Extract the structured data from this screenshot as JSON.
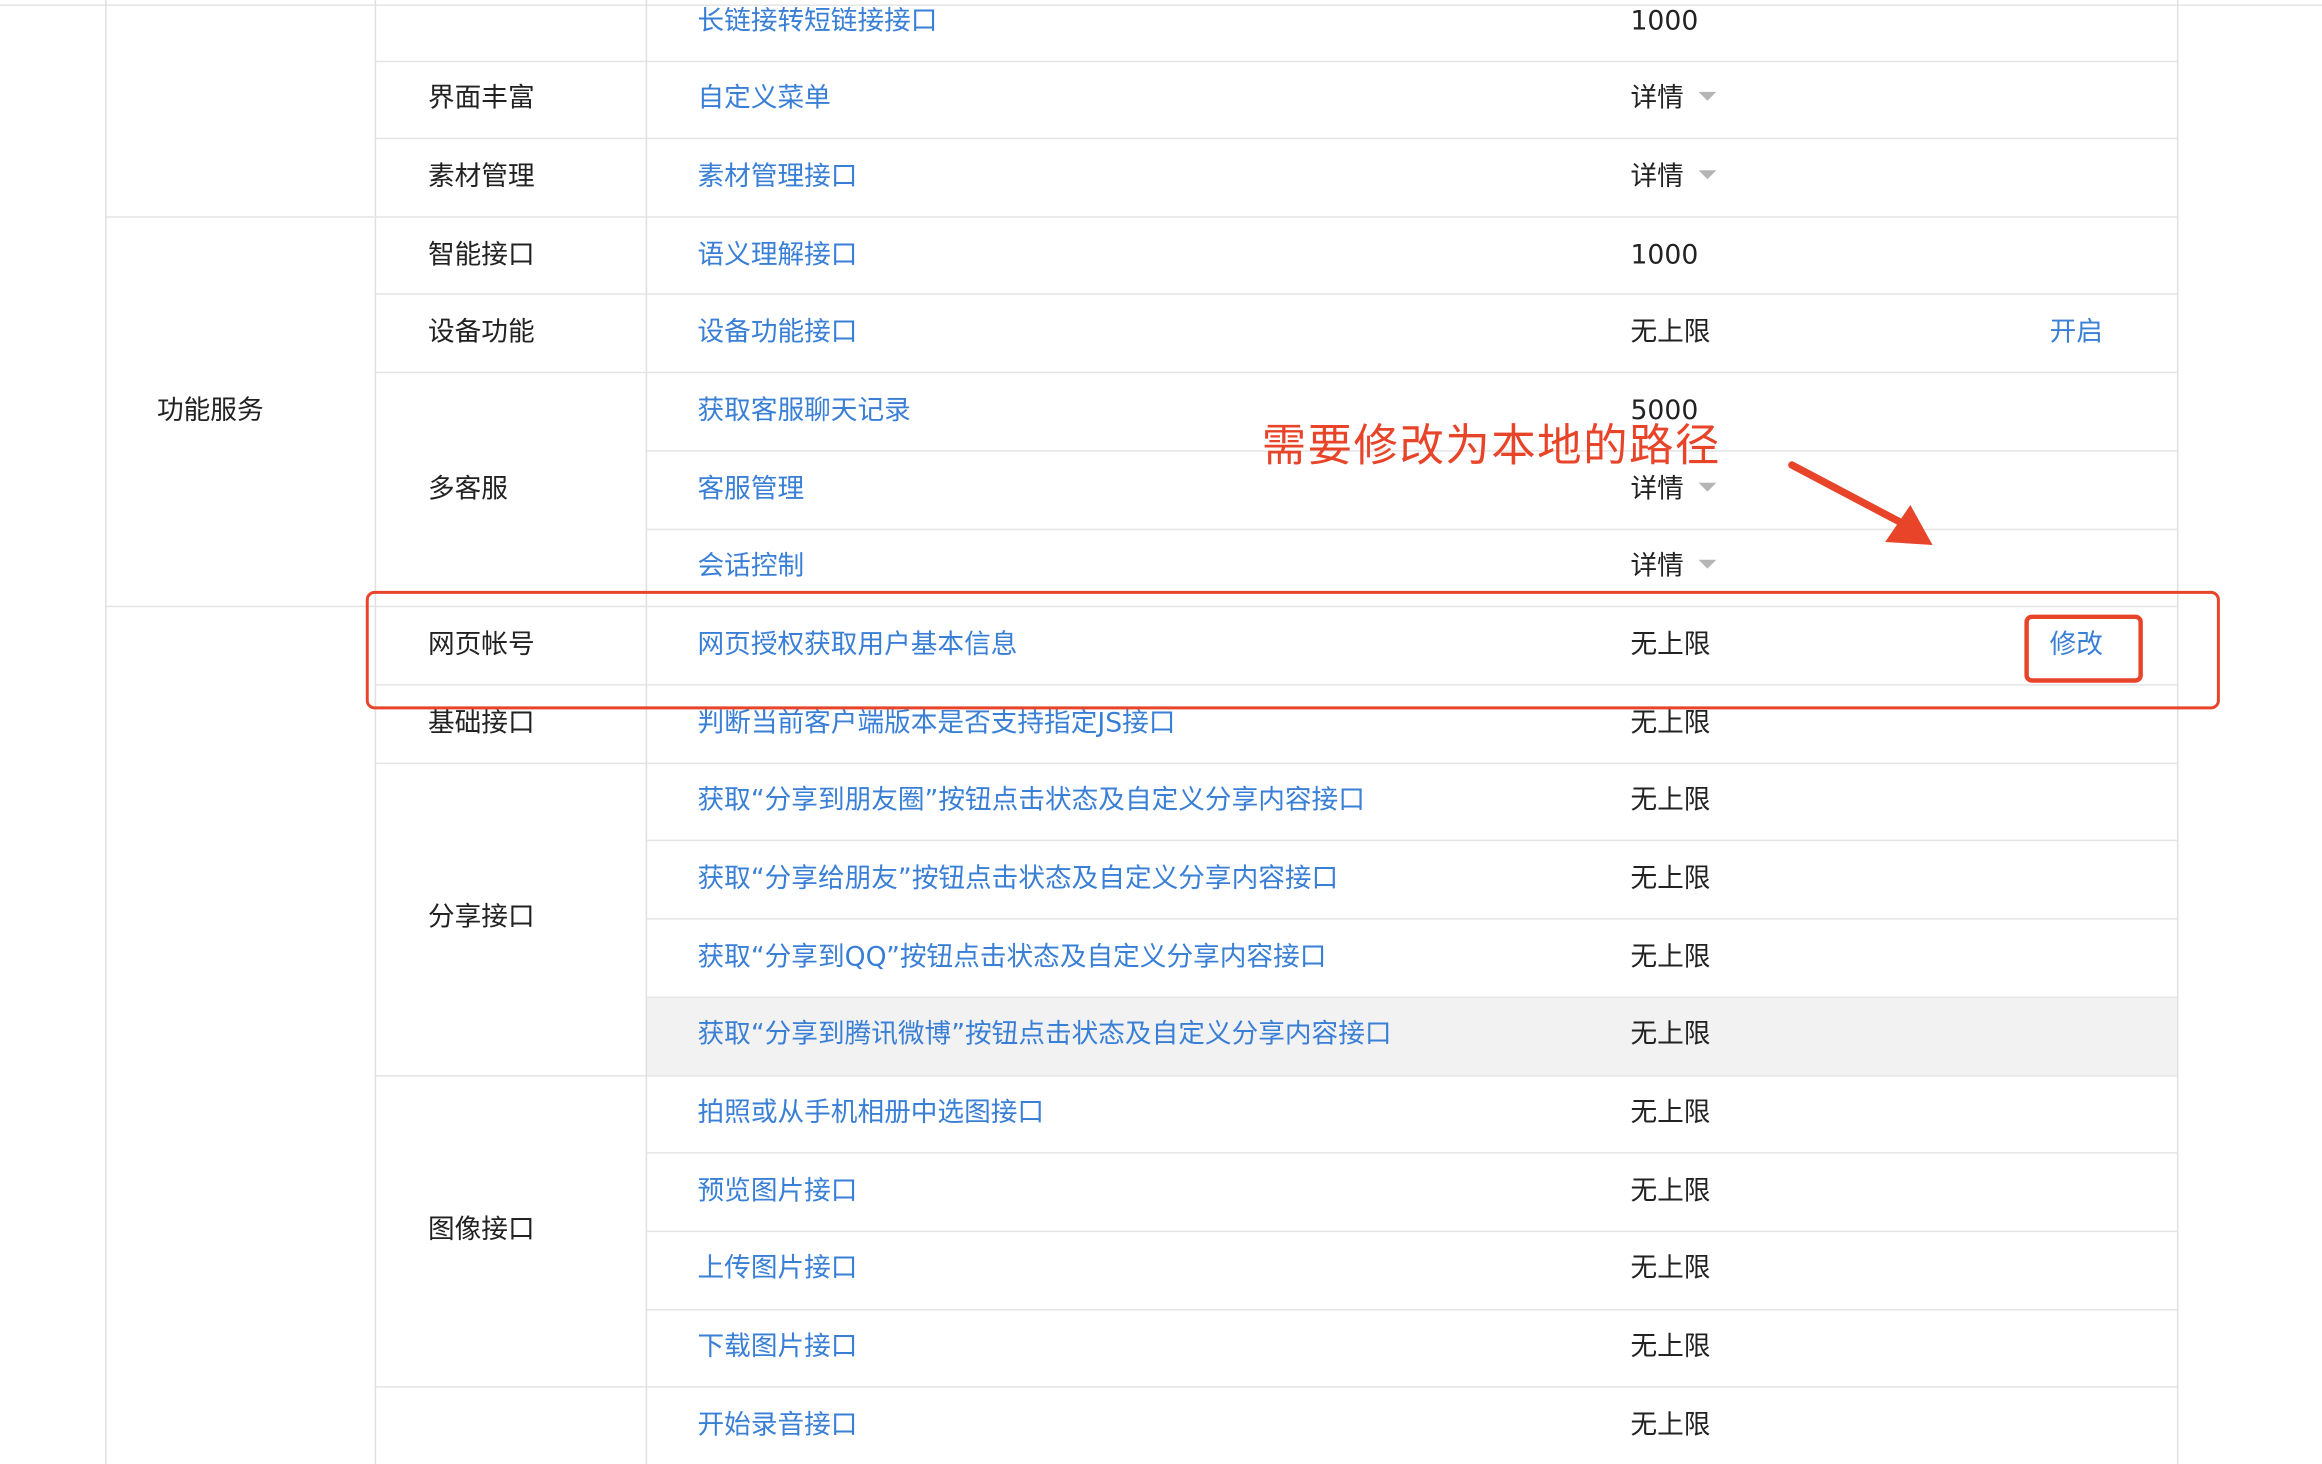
{
  "table": {
    "groups": [
      {
        "label": "功能服务"
      }
    ],
    "categories": [
      {
        "label": "界面丰富"
      },
      {
        "label": "素材管理"
      },
      {
        "label": "智能接口"
      },
      {
        "label": "设备功能"
      },
      {
        "label": "多客服"
      },
      {
        "label": "网页帐号"
      },
      {
        "label": "基础接口"
      },
      {
        "label": "分享接口"
      },
      {
        "label": "图像接口"
      }
    ],
    "rows": [
      {
        "name": "长链接转短链接接口",
        "quota": "1000",
        "action": ""
      },
      {
        "name": "自定义菜单",
        "quota": "详情",
        "action": ""
      },
      {
        "name": "素材管理接口",
        "quota": "详情",
        "action": ""
      },
      {
        "name": "语义理解接口",
        "quota": "1000",
        "action": ""
      },
      {
        "name": "设备功能接口",
        "quota": "无上限",
        "action": "开启"
      },
      {
        "name": "获取客服聊天记录",
        "quota": "5000",
        "action": ""
      },
      {
        "name": "客服管理",
        "quota": "详情",
        "action": ""
      },
      {
        "name": "会话控制",
        "quota": "详情",
        "action": ""
      },
      {
        "name": "网页授权获取用户基本信息",
        "quota": "无上限",
        "action": "修改"
      },
      {
        "name": "判断当前客户端版本是否支持指定JS接口",
        "quota": "无上限",
        "action": ""
      },
      {
        "name": "获取“分享到朋友圈”按钮点击状态及自定义分享内容接口",
        "quota": "无上限",
        "action": ""
      },
      {
        "name": "获取“分享给朋友”按钮点击状态及自定义分享内容接口",
        "quota": "无上限",
        "action": ""
      },
      {
        "name": "获取“分享到QQ”按钮点击状态及自定义分享内容接口",
        "quota": "无上限",
        "action": ""
      },
      {
        "name": "获取“分享到腾讯微博”按钮点击状态及自定义分享内容接口",
        "quota": "无上限",
        "action": ""
      },
      {
        "name": "拍照或从手机相册中选图接口",
        "quota": "无上限",
        "action": ""
      },
      {
        "name": "预览图片接口",
        "quota": "无上限",
        "action": ""
      },
      {
        "name": "上传图片接口",
        "quota": "无上限",
        "action": ""
      },
      {
        "name": "下载图片接口",
        "quota": "无上限",
        "action": ""
      },
      {
        "name": "开始录音接口",
        "quota": "无上限",
        "action": ""
      }
    ]
  },
  "annotation": {
    "text": "需要修改为本地的路径"
  },
  "colors": {
    "link": "#3a7fd6",
    "annotation": "#e8442a",
    "text": "#222222"
  },
  "icons": {
    "dropdown": "caret-down-icon",
    "annotation_arrow": "arrow-icon"
  }
}
